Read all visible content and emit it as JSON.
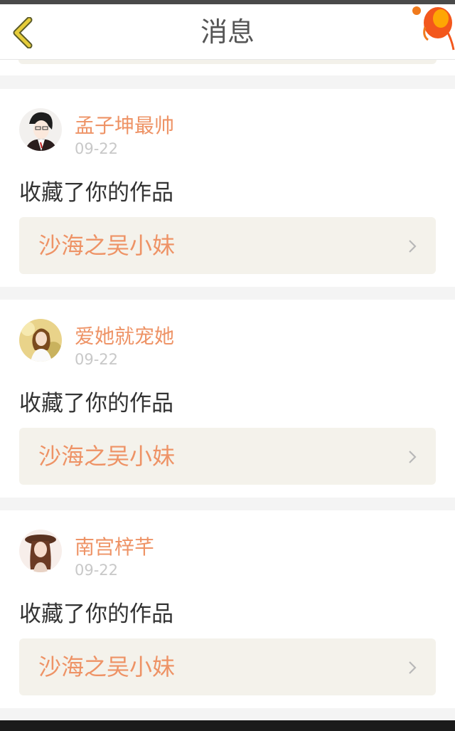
{
  "header": {
    "title": "消息",
    "back_icon": "chevron-left-icon",
    "decoration_icon": "lantern-icon"
  },
  "colors": {
    "accent": "#ee9366",
    "back_icon": "#e6cc3a",
    "text_main": "#333333",
    "date": "#c8c8c8",
    "link_bg": "#f4f2eb"
  },
  "messages": [
    {
      "username": "孟子坤最帅",
      "date": "09-22",
      "action": "收藏了你的作品",
      "work_title": "沙海之吴小妹"
    },
    {
      "username": "爱她就宠她",
      "date": "09-22",
      "action": "收藏了你的作品",
      "work_title": "沙海之吴小妹"
    },
    {
      "username": "南宫梓芊",
      "date": "09-22",
      "action": "收藏了你的作品",
      "work_title": "沙海之吴小妹"
    }
  ]
}
